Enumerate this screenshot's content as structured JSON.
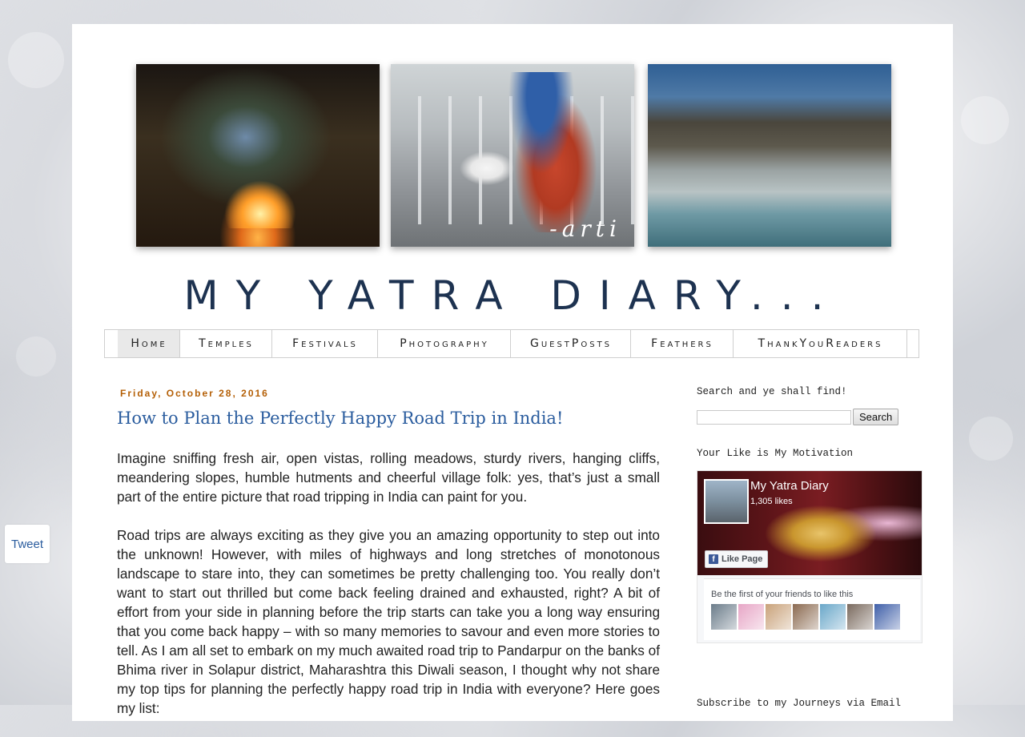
{
  "header": {
    "blog_title": "MY YATRA DIARY...",
    "photo_signature": "-arti"
  },
  "nav": {
    "items": [
      {
        "label": "Home",
        "active": true
      },
      {
        "label": "Temples",
        "active": false
      },
      {
        "label": "Festivals",
        "active": false
      },
      {
        "label": "Photography",
        "active": false
      },
      {
        "label": "GuestPosts",
        "active": false
      },
      {
        "label": "Feathers",
        "active": false
      },
      {
        "label": "ThankYouReaders",
        "active": false
      }
    ]
  },
  "post": {
    "date": "Friday, October 28, 2016",
    "title": "How to Plan the Perfectly Happy Road Trip in India!",
    "paragraphs": [
      "Imagine sniffing fresh air, open vistas, rolling meadows, sturdy rivers, hanging cliffs, meandering slopes, humble hutments and cheerful village folk: yes, that’s just a small part of the entire picture that road tripping in India can paint for you.",
      "Road trips are always exciting as they give you an amazing opportunity to step out into the unknown! However, with miles of highways and long stretches of monotonous landscape to stare into, they can sometimes be pretty challenging too. You really don’t want to start out thrilled but come back feeling drained and exhausted, right? A bit of effort from your side in planning before the trip starts can take you a long way ensuring that you come back happy – with so many memories to savour and even more stories to tell. As I am all set to embark on my much awaited road trip to Pandarpur on the banks of Bhima river in Solapur district, Maharashtra this Diwali season, I thought why not share my top tips for planning the perfectly happy road trip in India with everyone? Here goes my list:"
    ]
  },
  "sidebar": {
    "search_title": "Search and ye shall find!",
    "search_value": "",
    "search_button": "Search",
    "like_title": "Your Like is My Motivation",
    "fb": {
      "page_name": "My Yatra Diary",
      "likes": "1,305 likes",
      "like_button": "Like Page",
      "first_friends": "Be the first of your friends to like this",
      "face_colors": [
        "#6b7c8a",
        "#e7a6c6",
        "#c9a27a",
        "#8b6a50",
        "#6aa7c9",
        "#7a6a5e",
        "#3f5fa8"
      ]
    },
    "subscribe_title": "Subscribe to my Journeys via Email"
  },
  "tweet_label": "Tweet"
}
